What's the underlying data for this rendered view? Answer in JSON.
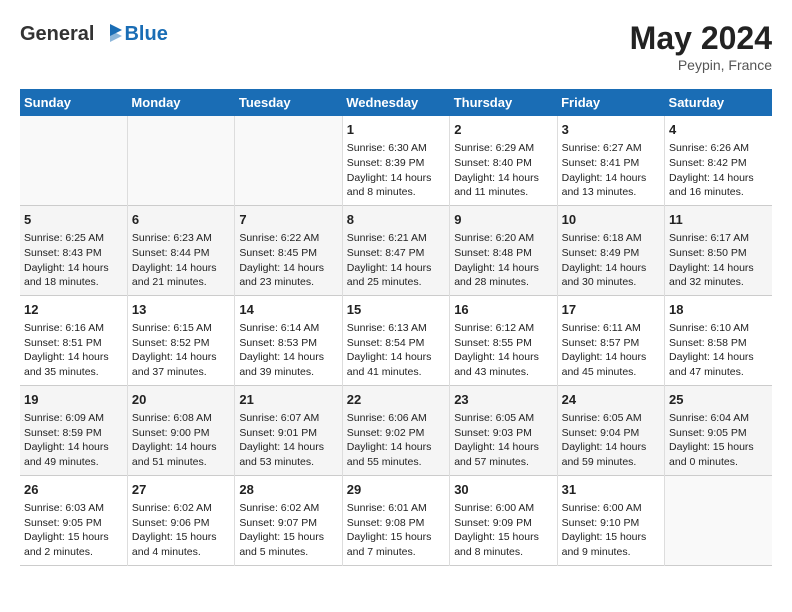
{
  "header": {
    "logo_general": "General",
    "logo_blue": "Blue",
    "month_year": "May 2024",
    "location": "Peypin, France"
  },
  "days_of_week": [
    "Sunday",
    "Monday",
    "Tuesday",
    "Wednesday",
    "Thursday",
    "Friday",
    "Saturday"
  ],
  "weeks": [
    [
      {
        "day": "",
        "info": ""
      },
      {
        "day": "",
        "info": ""
      },
      {
        "day": "",
        "info": ""
      },
      {
        "day": "1",
        "info": "Sunrise: 6:30 AM\nSunset: 8:39 PM\nDaylight: 14 hours\nand 8 minutes."
      },
      {
        "day": "2",
        "info": "Sunrise: 6:29 AM\nSunset: 8:40 PM\nDaylight: 14 hours\nand 11 minutes."
      },
      {
        "day": "3",
        "info": "Sunrise: 6:27 AM\nSunset: 8:41 PM\nDaylight: 14 hours\nand 13 minutes."
      },
      {
        "day": "4",
        "info": "Sunrise: 6:26 AM\nSunset: 8:42 PM\nDaylight: 14 hours\nand 16 minutes."
      }
    ],
    [
      {
        "day": "5",
        "info": "Sunrise: 6:25 AM\nSunset: 8:43 PM\nDaylight: 14 hours\nand 18 minutes."
      },
      {
        "day": "6",
        "info": "Sunrise: 6:23 AM\nSunset: 8:44 PM\nDaylight: 14 hours\nand 21 minutes."
      },
      {
        "day": "7",
        "info": "Sunrise: 6:22 AM\nSunset: 8:45 PM\nDaylight: 14 hours\nand 23 minutes."
      },
      {
        "day": "8",
        "info": "Sunrise: 6:21 AM\nSunset: 8:47 PM\nDaylight: 14 hours\nand 25 minutes."
      },
      {
        "day": "9",
        "info": "Sunrise: 6:20 AM\nSunset: 8:48 PM\nDaylight: 14 hours\nand 28 minutes."
      },
      {
        "day": "10",
        "info": "Sunrise: 6:18 AM\nSunset: 8:49 PM\nDaylight: 14 hours\nand 30 minutes."
      },
      {
        "day": "11",
        "info": "Sunrise: 6:17 AM\nSunset: 8:50 PM\nDaylight: 14 hours\nand 32 minutes."
      }
    ],
    [
      {
        "day": "12",
        "info": "Sunrise: 6:16 AM\nSunset: 8:51 PM\nDaylight: 14 hours\nand 35 minutes."
      },
      {
        "day": "13",
        "info": "Sunrise: 6:15 AM\nSunset: 8:52 PM\nDaylight: 14 hours\nand 37 minutes."
      },
      {
        "day": "14",
        "info": "Sunrise: 6:14 AM\nSunset: 8:53 PM\nDaylight: 14 hours\nand 39 minutes."
      },
      {
        "day": "15",
        "info": "Sunrise: 6:13 AM\nSunset: 8:54 PM\nDaylight: 14 hours\nand 41 minutes."
      },
      {
        "day": "16",
        "info": "Sunrise: 6:12 AM\nSunset: 8:55 PM\nDaylight: 14 hours\nand 43 minutes."
      },
      {
        "day": "17",
        "info": "Sunrise: 6:11 AM\nSunset: 8:57 PM\nDaylight: 14 hours\nand 45 minutes."
      },
      {
        "day": "18",
        "info": "Sunrise: 6:10 AM\nSunset: 8:58 PM\nDaylight: 14 hours\nand 47 minutes."
      }
    ],
    [
      {
        "day": "19",
        "info": "Sunrise: 6:09 AM\nSunset: 8:59 PM\nDaylight: 14 hours\nand 49 minutes."
      },
      {
        "day": "20",
        "info": "Sunrise: 6:08 AM\nSunset: 9:00 PM\nDaylight: 14 hours\nand 51 minutes."
      },
      {
        "day": "21",
        "info": "Sunrise: 6:07 AM\nSunset: 9:01 PM\nDaylight: 14 hours\nand 53 minutes."
      },
      {
        "day": "22",
        "info": "Sunrise: 6:06 AM\nSunset: 9:02 PM\nDaylight: 14 hours\nand 55 minutes."
      },
      {
        "day": "23",
        "info": "Sunrise: 6:05 AM\nSunset: 9:03 PM\nDaylight: 14 hours\nand 57 minutes."
      },
      {
        "day": "24",
        "info": "Sunrise: 6:05 AM\nSunset: 9:04 PM\nDaylight: 14 hours\nand 59 minutes."
      },
      {
        "day": "25",
        "info": "Sunrise: 6:04 AM\nSunset: 9:05 PM\nDaylight: 15 hours\nand 0 minutes."
      }
    ],
    [
      {
        "day": "26",
        "info": "Sunrise: 6:03 AM\nSunset: 9:05 PM\nDaylight: 15 hours\nand 2 minutes."
      },
      {
        "day": "27",
        "info": "Sunrise: 6:02 AM\nSunset: 9:06 PM\nDaylight: 15 hours\nand 4 minutes."
      },
      {
        "day": "28",
        "info": "Sunrise: 6:02 AM\nSunset: 9:07 PM\nDaylight: 15 hours\nand 5 minutes."
      },
      {
        "day": "29",
        "info": "Sunrise: 6:01 AM\nSunset: 9:08 PM\nDaylight: 15 hours\nand 7 minutes."
      },
      {
        "day": "30",
        "info": "Sunrise: 6:00 AM\nSunset: 9:09 PM\nDaylight: 15 hours\nand 8 minutes."
      },
      {
        "day": "31",
        "info": "Sunrise: 6:00 AM\nSunset: 9:10 PM\nDaylight: 15 hours\nand 9 minutes."
      },
      {
        "day": "",
        "info": ""
      }
    ]
  ]
}
